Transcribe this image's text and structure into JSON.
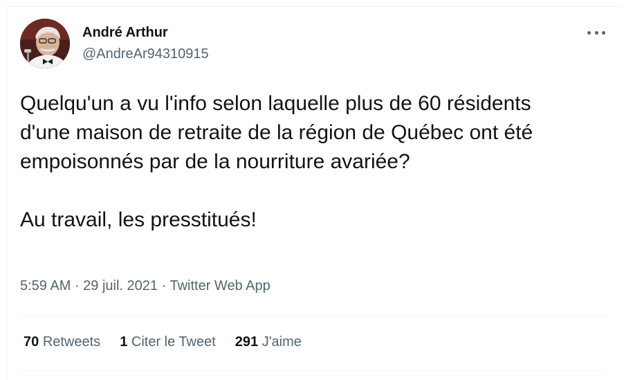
{
  "author": {
    "name": "André Arthur",
    "handle": "@AndreAr94310915",
    "avatar_icon": "profile-photo-avatar"
  },
  "tweet": {
    "paragraphs": [
      "Quelqu'un a vu l'info selon laquelle plus de 60 résidents d'une maison de retraite de la région de Québec ont été empoisonnés par de la nourriture avariée?",
      "Au travail, les presstitués!"
    ],
    "time": "5:59 AM",
    "date": "29 juil. 2021",
    "source": "Twitter Web App",
    "separator": " · "
  },
  "stats": {
    "retweets_count": "70",
    "retweets_label": "Retweets",
    "quotes_count": "1",
    "quotes_label": "Citer le Tweet",
    "likes_count": "291",
    "likes_label": "J'aime"
  },
  "colors": {
    "text_primary": "#0f1419",
    "text_secondary": "#536471",
    "divider": "#eff3f4"
  },
  "more_icon": "more-horizontal-icon"
}
